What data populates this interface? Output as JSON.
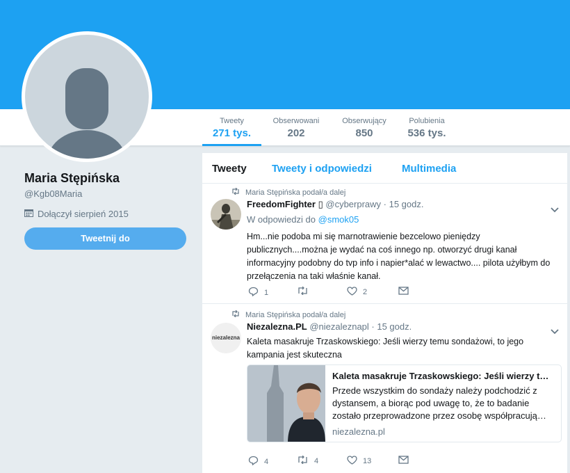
{
  "profile": {
    "name": "Maria Stępińska",
    "handle": "@Kgb08Maria",
    "joined": "Dołączył sierpień 2015",
    "tweet_button": "Tweetnij do"
  },
  "stats": [
    {
      "label": "Tweety",
      "value": "271 tys.",
      "active": true
    },
    {
      "label": "Obserwowani",
      "value": "202"
    },
    {
      "label": "Obserwujący",
      "value": "850"
    },
    {
      "label": "Polubienia",
      "value": "536 tys."
    }
  ],
  "tabs": [
    "Tweety",
    "Tweety i odpowiedzi",
    "Multimedia"
  ],
  "tweets": [
    {
      "retweet_note": "Maria Stępińska podał/a dalej",
      "author": "FreedomFighter",
      "author_badge": "▯",
      "handle_time": "@cyberprawy · 15 godz.",
      "reply_prefix": "W odpowiedzi do",
      "reply_to": "@smok05",
      "text": "Hm...nie podoba mi się marnotrawienie bezcelowo pieniędzy publicznych....można je wydać na coś innego np. otworzyć drugi kanał informacyjny podobny do tvp info i napier*alać w lewactwo.... pilota użyłbym do przełączenia na taki właśnie kanał.",
      "replies": "1",
      "retweets": "",
      "likes": "2"
    },
    {
      "retweet_note": "Maria Stępińska podał/a dalej",
      "author": "Niezalezna.PL",
      "avatar_text": "niezalezna",
      "handle_time": "@niezaleznapl · 15 godz.",
      "text": "Kaleta masakruje Trzaskowskiego: Jeśli wierzy temu sondażowi, to jego kampania jest skuteczna",
      "card": {
        "title": "Kaleta masakruje Trzaskowskiego: Jeśli wierzy t…",
        "description": "Przede wszystkim do sondaży należy podchodzić z dystansem, a biorąc pod uwagę to, że to badanie zostało przeprowadzone przez osobę współpracują…",
        "domain": "niezalezna.pl"
      },
      "replies": "4",
      "retweets": "4",
      "likes": "13"
    }
  ],
  "colors": {
    "accent": "#1da1f2",
    "button": "#55acee",
    "background": "#e6ecf0",
    "muted": "#657786"
  },
  "icons": [
    "retweet-icon",
    "reply-icon",
    "like-icon",
    "message-icon",
    "calendar-icon",
    "chevron-down-icon"
  ]
}
